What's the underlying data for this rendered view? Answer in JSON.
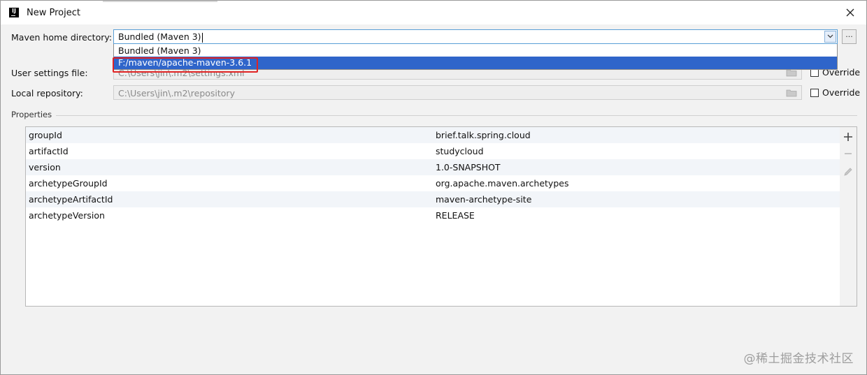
{
  "window": {
    "title": "New Project",
    "app_icon_text": "IJ"
  },
  "maven_home": {
    "label": "Maven home directory:",
    "value": "Bundled (Maven 3)",
    "browse_label": "...",
    "options": [
      "Bundled (Maven 3)",
      "F:/maven/apache-maven-3.6.1"
    ],
    "selected_option_index": 1
  },
  "user_settings": {
    "label": "User settings file:",
    "value": "C:\\Users\\jin\\.m2\\settings.xml",
    "override_label": "Override",
    "override_checked": false
  },
  "local_repository": {
    "label": "Local repository:",
    "value": "C:\\Users\\jin\\.m2\\repository",
    "override_label": "Override",
    "override_checked": false
  },
  "properties": {
    "title": "Properties",
    "rows": [
      {
        "name": "groupId",
        "value": "brief.talk.spring.cloud"
      },
      {
        "name": "artifactId",
        "value": "studycloud"
      },
      {
        "name": "version",
        "value": "1.0-SNAPSHOT"
      },
      {
        "name": "archetypeGroupId",
        "value": "org.apache.maven.archetypes"
      },
      {
        "name": "archetypeArtifactId",
        "value": "maven-archetype-site"
      },
      {
        "name": "archetypeVersion",
        "value": "RELEASE"
      }
    ],
    "toolbar": [
      "add-icon",
      "remove-icon",
      "edit-icon"
    ]
  },
  "watermark": "@稀土掘金技术社区",
  "colors": {
    "selection": "#2f65ca",
    "annotation_box": "#e02424",
    "focus_border": "#5a9fd6"
  }
}
